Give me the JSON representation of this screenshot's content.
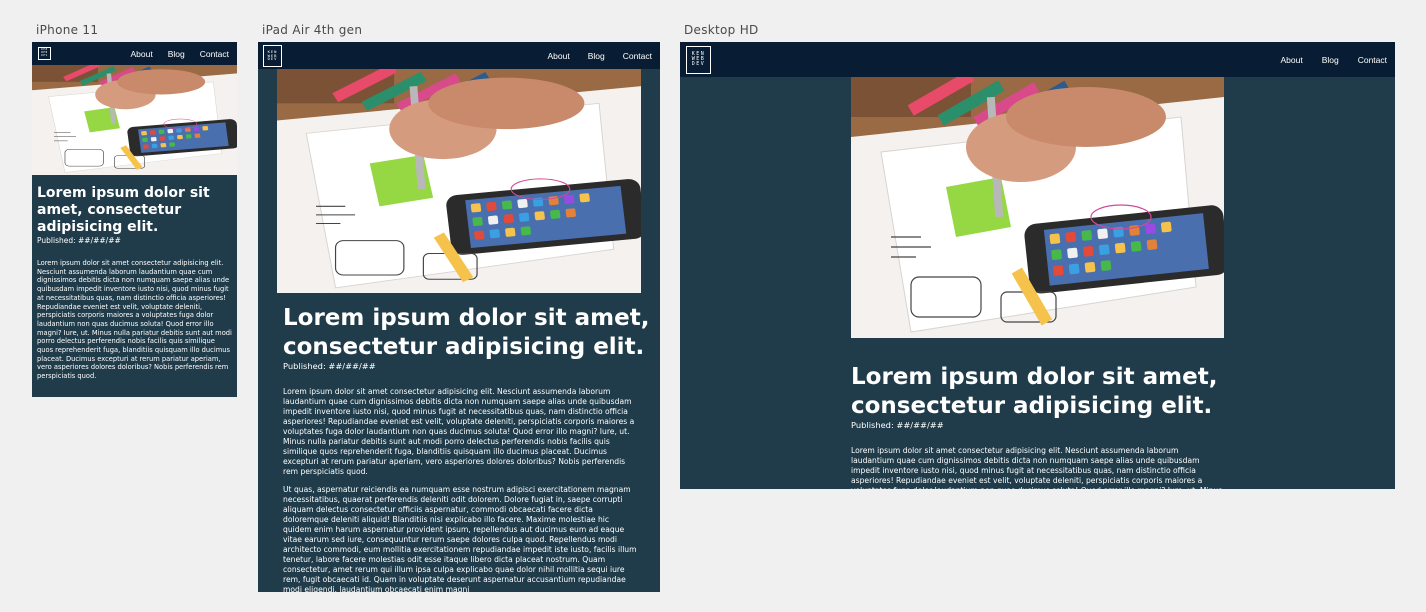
{
  "frames": [
    {
      "label": "iPhone 11"
    },
    {
      "label": "iPad Air 4th gen"
    },
    {
      "label": "Desktop HD"
    }
  ],
  "logo": {
    "lines": [
      "KEN",
      "WEB",
      "DEV"
    ]
  },
  "nav": {
    "about": "About",
    "blog": "Blog",
    "contact": "Contact"
  },
  "article": {
    "title": "Lorem ipsum dolor sit amet, consectetur adipisicing elit.",
    "published": "Published: ##/##/##",
    "paragraph1": "Lorem ipsum dolor sit amet consectetur adipisicing elit. Nesciunt assumenda laborum laudantium quae cum dignissimos debitis dicta non numquam saepe alias unde quibusdam impedit inventore iusto nisi, quod minus fugit at necessitatibus quas, nam distinctio officia asperiores! Repudiandae eveniet est velit, voluptate deleniti, perspiciatis corporis maiores a voluptates fuga dolor laudantium non quas ducimus soluta! Quod error illo magni? Iure, ut. Minus nulla pariatur debitis sunt aut modi porro delectus perferendis nobis facilis quis similique quos reprehenderit fuga, blanditiis quisquam illo ducimus placeat. Ducimus excepturi at rerum pariatur aperiam, vero asperiores dolores doloribus? Nobis perferendis rem perspiciatis quod.",
    "paragraph2": "Ut quas, aspernatur reiciendis ea numquam esse nostrum adipisci exercitationem magnam necessitatibus, quaerat perferendis deleniti odit dolorem. Dolore fugiat in, saepe corrupti aliquam delectus consectetur officiis aspernatur, commodi obcaecati facere dicta doloremque deleniti aliquid! Blanditiis nisi explicabo illo facere. Maxime molestiae hic quidem enim harum aspernatur provident ipsum, repellendus aut ducimus eum ad eaque vitae earum sed iure, consequuntur rerum saepe dolores culpa quod. Repellendus modi architecto commodi, eum mollitia exercitationem repudiandae impedit iste iusto, facilis illum tenetur, labore facere molestias odit esse itaque libero dicta placeat nostrum. Quam consectetur, amet rerum qui illum ipsa culpa explicabo quae dolor nihil mollitia sequi iure rem, fugit obcaecati id. Quam in voluptate deserunt aspernatur accusantium repudiandae modi eligendi, laudantium obcaecati enim magni"
  },
  "hero_image": {
    "icon": "desk-sketch-phone-photo"
  },
  "colors": {
    "nav": "#081d33",
    "page": "#203c4a",
    "canvas": "#f0f0f0",
    "text": "#ffffff"
  }
}
